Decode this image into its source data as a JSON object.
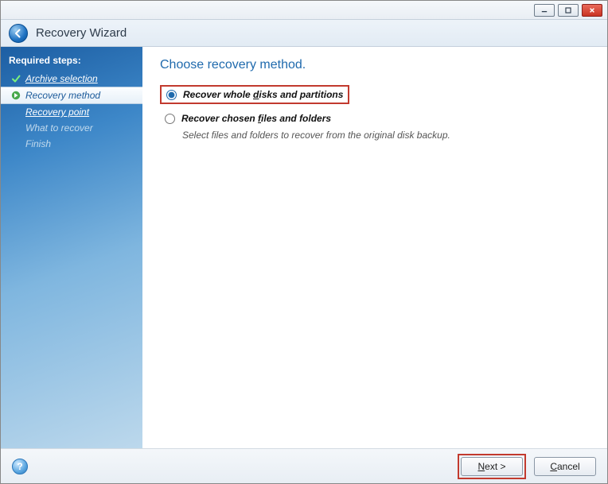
{
  "window": {
    "title": "Recovery Wizard"
  },
  "sidebar": {
    "heading": "Required steps:",
    "steps": [
      {
        "label": "Archive selection",
        "state": "completed"
      },
      {
        "label": "Recovery method",
        "state": "current"
      },
      {
        "label": "Recovery point",
        "state": "pending-link"
      },
      {
        "label": "What to recover",
        "state": "disabled"
      },
      {
        "label": "Finish",
        "state": "disabled"
      }
    ]
  },
  "main": {
    "title": "Choose recovery method.",
    "options": [
      {
        "id": "whole",
        "label_pre": "Recover whole ",
        "label_ul": "d",
        "label_post": "isks and partitions",
        "selected": true,
        "highlighted": true
      },
      {
        "id": "chosen",
        "label_pre": "Recover chosen ",
        "label_ul": "f",
        "label_post": "iles and folders",
        "selected": false,
        "description": "Select files and folders to recover from the original disk backup."
      }
    ]
  },
  "footer": {
    "next_pre": "",
    "next_ul": "N",
    "next_post": "ext >",
    "cancel_pre": "",
    "cancel_ul": "C",
    "cancel_post": "ancel",
    "next_highlighted": true
  }
}
